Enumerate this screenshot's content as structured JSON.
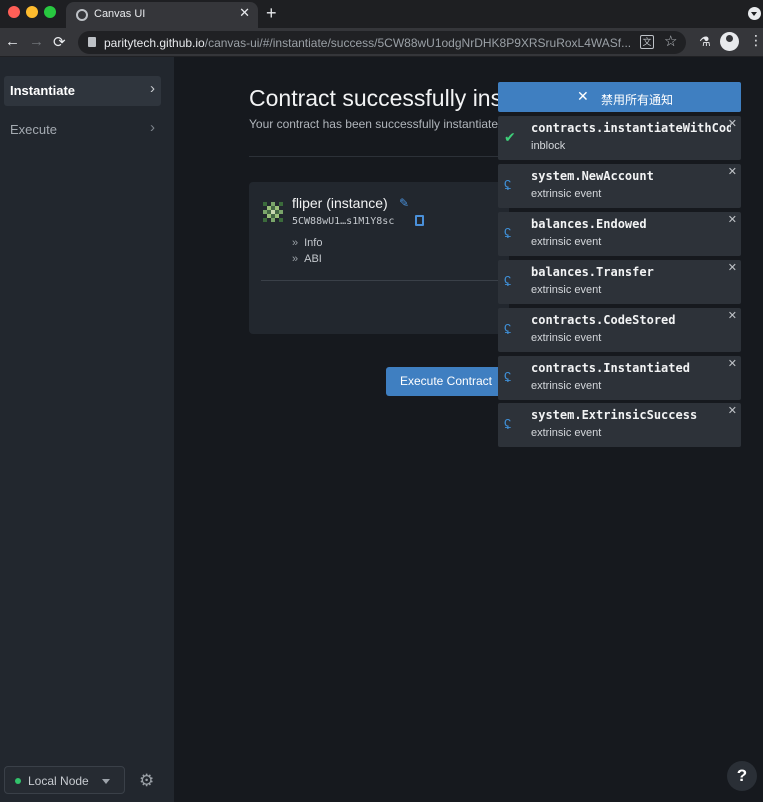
{
  "browser": {
    "tab_title": "Canvas UI",
    "tab_close": "✕",
    "new_tab": "+",
    "url_host": "paritytech.github.io",
    "url_path": "/canvas-ui/#/instantiate/success/5CW88wU1odgNrDHK8P9XRSruRoxL4WASf...",
    "translate_glyph": "文",
    "nav": {
      "back": "←",
      "forward": "→",
      "reload": "⟳"
    },
    "icons": [
      "globe-icon",
      "lock-icon",
      "translate-icon",
      "star-icon",
      "extension-icon",
      "profile-icon",
      "more-icon"
    ]
  },
  "sidebar": {
    "items": [
      {
        "label": "Instantiate",
        "active": true
      },
      {
        "label": "Execute",
        "active": false
      }
    ],
    "node": {
      "label": "Local Node",
      "status_color": "#32c36b"
    }
  },
  "main": {
    "title": "Contract successfully instantiated",
    "subtitle": "Your contract has been successfully instantiated",
    "card": {
      "name": "fliper (instance)",
      "address": "5CW88wU1…s1M1Y8sc",
      "links": [
        {
          "label": "Info"
        },
        {
          "label": "ABI"
        }
      ]
    },
    "execute_button": "Execute Contract",
    "help": "?"
  },
  "notifications": {
    "header": "禁用所有通知",
    "close_glyph": "✕",
    "items": [
      {
        "title": "contracts.instantiateWithCode",
        "subtitle": "inblock",
        "icon": "check-icon"
      },
      {
        "title": "system.NewAccount",
        "subtitle": "extrinsic event",
        "icon": "ear-icon"
      },
      {
        "title": "balances.Endowed",
        "subtitle": "extrinsic event",
        "icon": "ear-icon"
      },
      {
        "title": "balances.Transfer",
        "subtitle": "extrinsic event",
        "icon": "ear-icon"
      },
      {
        "title": "contracts.CodeStored",
        "subtitle": "extrinsic event",
        "icon": "ear-icon"
      },
      {
        "title": "contracts.Instantiated",
        "subtitle": "extrinsic event",
        "icon": "ear-icon"
      },
      {
        "title": "system.ExtrinsicSuccess",
        "subtitle": "extrinsic event",
        "icon": "ear-icon"
      }
    ]
  },
  "colors": {
    "accent": "#3f7fc1",
    "success": "#3ecf79",
    "event_icon": "#3f8fd6",
    "sidebar_bg": "#22272e",
    "main_bg": "#16191e"
  }
}
